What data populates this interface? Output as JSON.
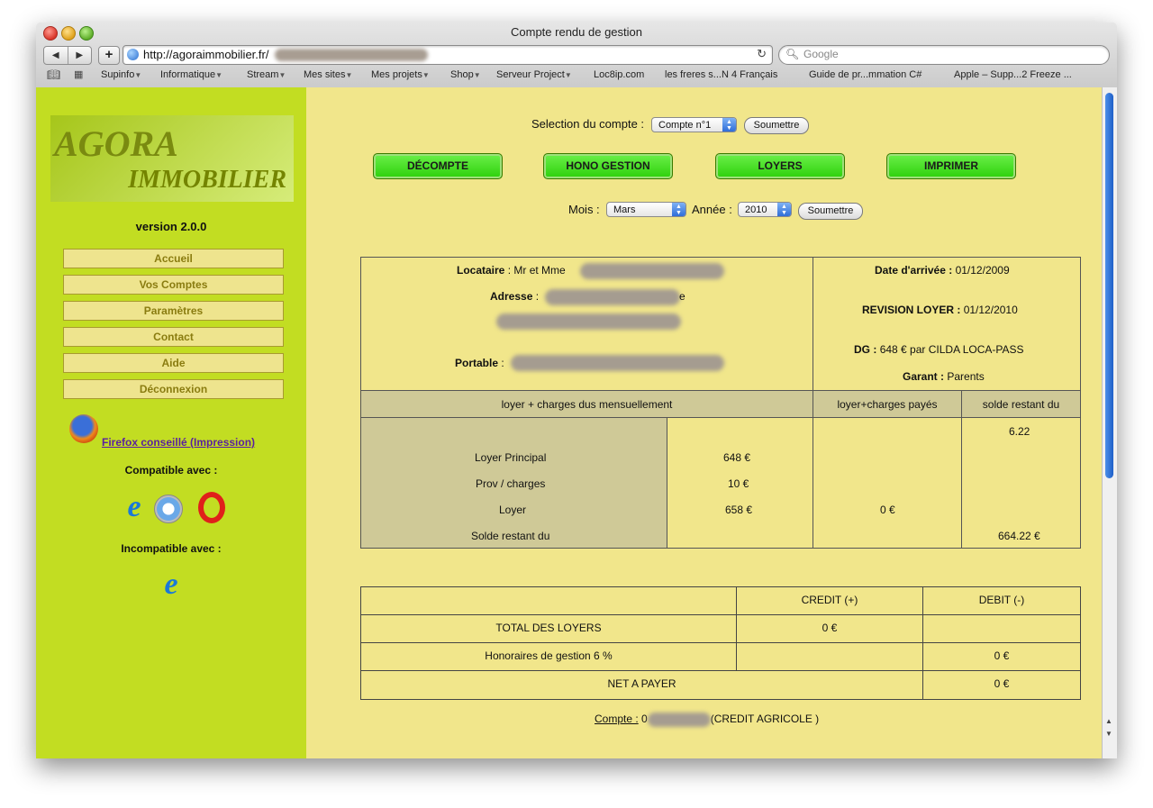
{
  "window": {
    "title": "Compte rendu de gestion",
    "url": "http://agoraimmobilier.fr/",
    "search_placeholder": "Google"
  },
  "bookmarks": [
    "Supinfo",
    "Informatique",
    "Stream",
    "Mes sites",
    "Mes projets",
    "Shop",
    "Serveur Project",
    "Loc8ip.com",
    "les freres s...N 4 Français",
    "Guide de pr...mmation C#",
    "Apple – Supp...2 Freeze ..."
  ],
  "sidebar": {
    "logo_line1": "AGORA",
    "logo_line2": "IMMOBILIER",
    "version": "version 2.0.0",
    "menu": [
      "Accueil",
      "Vos Comptes",
      "Paramètres",
      "Contact",
      "Aide",
      "Déconnexion"
    ],
    "firefox_link": "Firefox conseillé (Impression)",
    "compatible_label": "Compatible avec :",
    "incompatible_label": "Incompatible avec :"
  },
  "form": {
    "account_label": "Selection du compte :",
    "account_value": "Compte n°1",
    "submit_label": "Soumettre",
    "month_label": "Mois :",
    "month_value": "Mars",
    "year_label": "Année :",
    "year_value": "2010"
  },
  "actions": [
    "DÉCOMPTE",
    "HONO GESTION",
    "LOYERS",
    "IMPRIMER"
  ],
  "tenant": {
    "locataire_label": "Locataire",
    "locataire_value": ": Mr et Mme",
    "adresse_label": "Adresse",
    "adresse_colon": ":",
    "adresse_tail": "e",
    "portable_label": "Portable",
    "portable_colon": ":",
    "arrivee_label": "Date d'arrivée :",
    "arrivee_value": "01/12/2009",
    "revision_label": "REVISION LOYER :",
    "revision_value": "01/12/2010",
    "dg_label": "DG :",
    "dg_value": "648 € par CILDA LOCA-PASS",
    "garant_label": "Garant :",
    "garant_value": "Parents"
  },
  "summary": {
    "headers": [
      "loyer + charges dus mensuellement",
      "loyer+charges payés",
      "solde restant du"
    ],
    "solde_initial": "6.22",
    "rows": [
      {
        "label": "Loyer Principal",
        "amount": "648  €",
        "paid": "",
        "balance": ""
      },
      {
        "label": "Prov / charges",
        "amount": "10  €",
        "paid": "",
        "balance": ""
      },
      {
        "label": "Loyer",
        "amount": "658 €",
        "paid": "0 €",
        "balance": ""
      },
      {
        "label": "Solde restant du",
        "amount": "",
        "paid": "",
        "balance": "664.22 €"
      }
    ]
  },
  "ledger": {
    "credit_header": "CREDIT (+)",
    "debit_header": "DEBIT (-)",
    "total_label": "TOTAL DES LOYERS",
    "total_credit": "0 €",
    "honoraires_label": "Honoraires de gestion 6 %",
    "honoraires_debit": "0 €",
    "net_label": "NET A PAYER",
    "net_debit": "0 €"
  },
  "account_footer": {
    "label": "Compte :",
    "prefix": "0",
    "bank": "(CREDIT AGRICOLE )"
  }
}
